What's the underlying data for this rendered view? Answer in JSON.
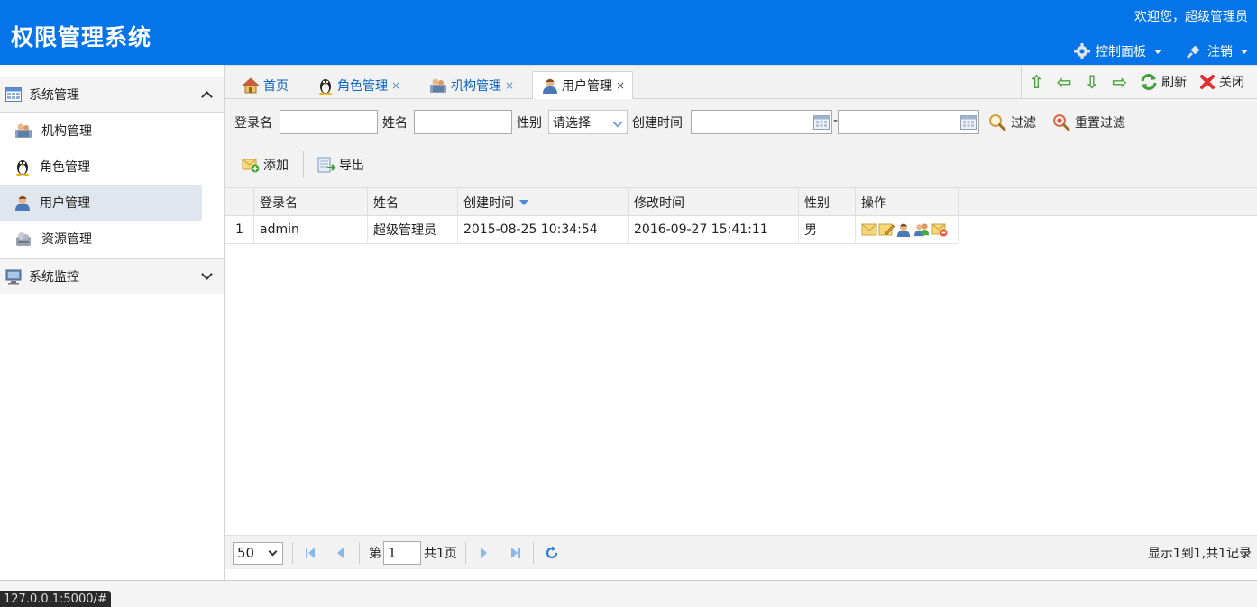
{
  "header": {
    "title": "权限管理系统",
    "welcome": "欢迎您，超级管理员",
    "control_panel": "控制面板",
    "logout": "注销"
  },
  "sidebar": {
    "groups": [
      {
        "label": "系统管理",
        "icon": "grid-icon",
        "expanded": true
      },
      {
        "label": "系统监控",
        "icon": "monitor-icon",
        "expanded": false
      }
    ],
    "items": [
      {
        "label": "机构管理",
        "icon": "org-icon"
      },
      {
        "label": "角色管理",
        "icon": "penguin-icon"
      },
      {
        "label": "用户管理",
        "icon": "user-icon",
        "active": true
      },
      {
        "label": "资源管理",
        "icon": "resource-icon"
      }
    ]
  },
  "tabs": [
    {
      "label": "首页",
      "icon": "home-icon",
      "closable": false
    },
    {
      "label": "角色管理",
      "icon": "penguin-icon",
      "closable": true
    },
    {
      "label": "机构管理",
      "icon": "org-icon",
      "closable": true
    },
    {
      "label": "用户管理",
      "icon": "user-icon",
      "closable": true,
      "active": true
    }
  ],
  "tab_close": "×",
  "tab_tools": {
    "refresh": "刷新",
    "close": "关闭"
  },
  "filters": {
    "login_label": "登录名",
    "name_label": "姓名",
    "gender_label": "性别",
    "gender_value": "请选择",
    "created_label": "创建时间",
    "range_sep": "-",
    "filter_btn": "过滤",
    "reset_btn": "重置过滤"
  },
  "toolbar": {
    "add": "添加",
    "export": "导出"
  },
  "grid": {
    "columns": [
      "登录名",
      "姓名",
      "创建时间",
      "修改时间",
      "性别",
      "操作"
    ],
    "sorted_column": "创建时间",
    "rows": [
      {
        "num": "1",
        "login": "admin",
        "name": "超级管理员",
        "created": "2015-08-25 10:34:54",
        "modified": "2016-09-27 15:41:11",
        "gender": "男"
      }
    ]
  },
  "pager": {
    "page_size": "50",
    "page_prefix": "第",
    "page_value": "1",
    "page_total": "共1页",
    "summary": "显示1到1,共1记录"
  },
  "status_url": "127.0.0.1:5000/#",
  "colors": {
    "header": "#0574e8",
    "accent": "#0b63c4"
  }
}
